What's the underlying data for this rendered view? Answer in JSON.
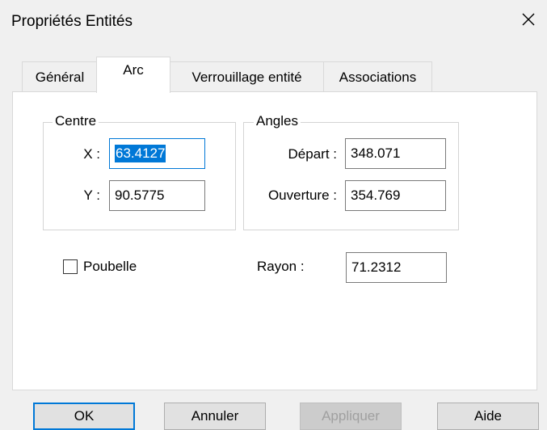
{
  "window": {
    "title": "Propriétés Entités",
    "close_icon": "close-icon"
  },
  "tabs": [
    {
      "label": "Général"
    },
    {
      "label": "Arc",
      "active": true
    },
    {
      "label": "Verrouillage entité"
    },
    {
      "label": "Associations"
    }
  ],
  "centre": {
    "legend": "Centre",
    "x_label": "X :",
    "x_value": "63.4127",
    "y_label": "Y :",
    "y_value": "90.5775"
  },
  "angles": {
    "legend": "Angles",
    "depart_label": "Départ :",
    "depart_value": "348.071",
    "ouverture_label": "Ouverture :",
    "ouverture_value": "354.769"
  },
  "poubelle": {
    "label": "Poubelle",
    "checked": false
  },
  "rayon": {
    "label": "Rayon :",
    "value": "71.2312"
  },
  "buttons": {
    "ok": "OK",
    "annuler": "Annuler",
    "appliquer": "Appliquer",
    "aide": "Aide"
  }
}
